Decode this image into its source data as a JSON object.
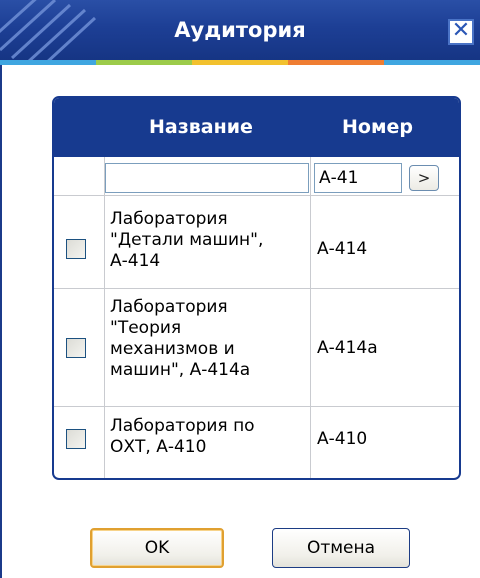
{
  "window": {
    "title": "Аудитория",
    "close_glyph": "✕"
  },
  "grid": {
    "columns": [
      {
        "label": "Название"
      },
      {
        "label": "Номер"
      }
    ],
    "filter": {
      "name_value": "",
      "number_value": "А-41",
      "go_label": ">"
    },
    "rows": [
      {
        "checked": false,
        "name_lines": [
          "Лаборатория",
          "\"Детали машин\",",
          "А-414"
        ],
        "number": "А-414"
      },
      {
        "checked": false,
        "name_lines": [
          "Лаборатория",
          "\"Теория",
          "механизмов и",
          "машин\", А-414а"
        ],
        "number": "А-414а"
      },
      {
        "checked": false,
        "name_lines": [
          "Лаборатория по",
          "ОХТ, А-410"
        ],
        "number": "А-410"
      }
    ]
  },
  "buttons": {
    "ok_label": "OK",
    "cancel_label": "Отмена"
  },
  "colors": {
    "title_bar": "#1d3f95",
    "grid_header": "#173a8f",
    "accent_strip": [
      "#3fa6e0",
      "#9ccb4a",
      "#f2c12e",
      "#ef7d32",
      "#3fa6e0"
    ]
  },
  "icons": {
    "close": "close-icon",
    "go": "chevron-right-icon"
  }
}
